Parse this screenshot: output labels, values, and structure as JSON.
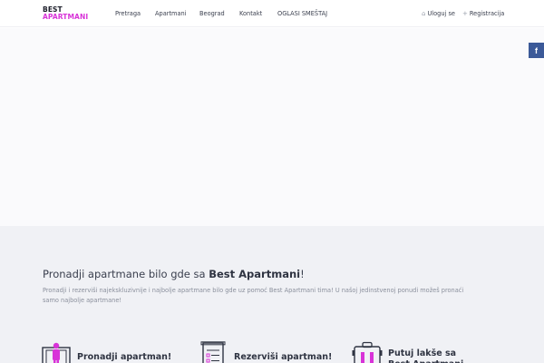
{
  "header": {
    "logo": {
      "line1": "BEST",
      "line2": "APARTMANI"
    },
    "nav": [
      {
        "label": "Pretraga"
      },
      {
        "label": "Apartmani"
      },
      {
        "label": "Beograd"
      },
      {
        "label": "Kontakt"
      },
      {
        "label": "OGLASI SMEŠTAJ"
      }
    ],
    "login_label": "Uloguj se",
    "register_label": "Registracija"
  },
  "social": {
    "facebook_glyph": "f"
  },
  "info": {
    "title_prefix": "Pronadji apartmane bilo gde sa ",
    "title_brand": "Best Apartmani",
    "title_suffix": "!",
    "description": "Pronadji i rezerviši najekskluzivnije i najbolje apartmane bilo gde uz pomoć Best Apartmani tima! U našoj jedinstvenoj ponudi možeš pronaći samo najbolje apartmane!",
    "features": [
      {
        "label": "Pronadji apartman!",
        "icon": "hotel-door-icon"
      },
      {
        "label": "Rezerviši apartman!",
        "icon": "checklist-icon"
      },
      {
        "label": "Putuj lakše sa Best Apartmani",
        "icon": "luggage-icon"
      }
    ]
  },
  "colors": {
    "brand_accent": "#d833d8",
    "facebook": "#3b5998"
  }
}
